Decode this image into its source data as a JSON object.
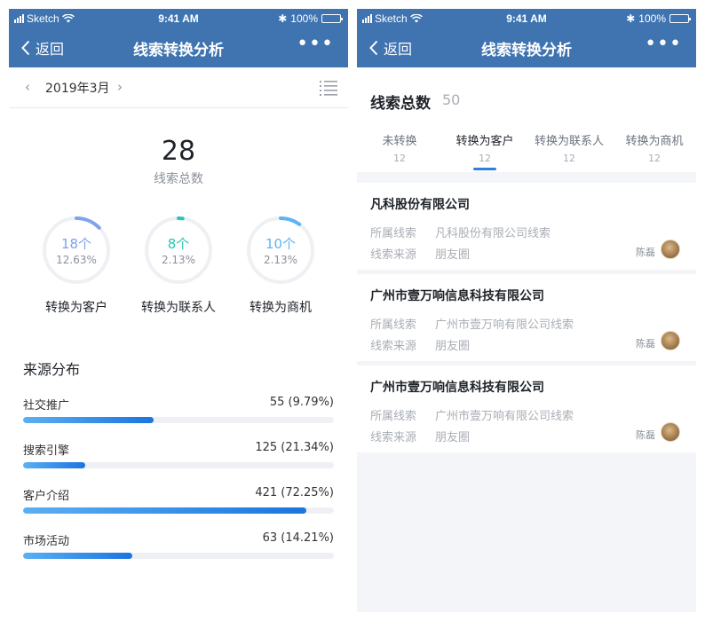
{
  "status_bar": {
    "carrier": "Sketch",
    "time": "9:41 AM",
    "battery": "100%"
  },
  "nav": {
    "back_label": "返回",
    "title": "线索转换分析",
    "more": "•••"
  },
  "left": {
    "month": {
      "label": "2019年3月",
      "prev": "‹",
      "next": "›"
    },
    "total": {
      "value": "28",
      "label": "线索总数"
    },
    "rings": [
      {
        "count": "18个",
        "pct": "12.63%",
        "caption": "转换为客户",
        "fraction": 0.1263,
        "color": "#7ea3ea"
      },
      {
        "count": "8个",
        "pct": "2.13%",
        "caption": "转换为联系人",
        "fraction": 0.0213,
        "color": "#2cc5b1"
      },
      {
        "count": "10个",
        "pct": "2.13%",
        "caption": "转换为商机",
        "fraction": 0.1,
        "color": "#5cb4f3"
      }
    ],
    "sources": {
      "title": "来源分布",
      "items": [
        {
          "name": "社交推广",
          "value": "55 (9.79%)",
          "fill": 0.42
        },
        {
          "name": "搜索引擎",
          "value": "125 (21.34%)",
          "fill": 0.2
        },
        {
          "name": "客户介绍",
          "value": "421 (72.25%)",
          "fill": 0.91
        },
        {
          "name": "市场活动",
          "value": "63 (14.21%)",
          "fill": 0.35
        }
      ]
    }
  },
  "right": {
    "summary": {
      "title": "线索总数",
      "count": "50"
    },
    "tabs": [
      {
        "label": "未转换",
        "count": "12"
      },
      {
        "label": "转换为客户",
        "count": "12",
        "active": true
      },
      {
        "label": "转换为联系人",
        "count": "12"
      },
      {
        "label": "转换为商机",
        "count": "12"
      }
    ],
    "cards": [
      {
        "name": "凡科股份有限公司",
        "k1": "所属线索",
        "v1": "凡科股份有限公司线索",
        "k2": "线索来源",
        "v2": "朋友圈",
        "owner": "陈磊"
      },
      {
        "name": "广州市壹万响信息科技有限公司",
        "k1": "所属线索",
        "v1": "广州市壹万响有限公司线索",
        "k2": "线索来源",
        "v2": "朋友圈",
        "owner": "陈磊"
      },
      {
        "name": "广州市壹万响信息科技有限公司",
        "k1": "所属线索",
        "v1": "广州市壹万响有限公司线索",
        "k2": "线索来源",
        "v2": "朋友圈",
        "owner": "陈磊"
      }
    ]
  },
  "colors": {
    "nav_bg": "#3f74b1",
    "accent": "#2f7de1",
    "bar_start": "#5bb0f2",
    "bar_end": "#1c74e0"
  }
}
